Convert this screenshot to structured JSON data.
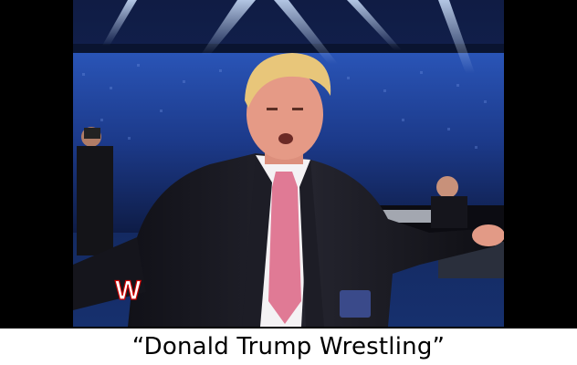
{
  "caption": "“Donald Trump Wrestling”",
  "photo": {
    "subject": "man in dark suit with pink tie in an arena",
    "logo_text": "W"
  },
  "colors": {
    "letterbox": "#000000",
    "caption_background": "#ffffff",
    "caption_text": "#000000",
    "crowd": "#1c3a8a",
    "suit": "#1a1a22",
    "tie": "#e07a95",
    "hair": "#e8c67a",
    "skin": "#e59a86"
  }
}
